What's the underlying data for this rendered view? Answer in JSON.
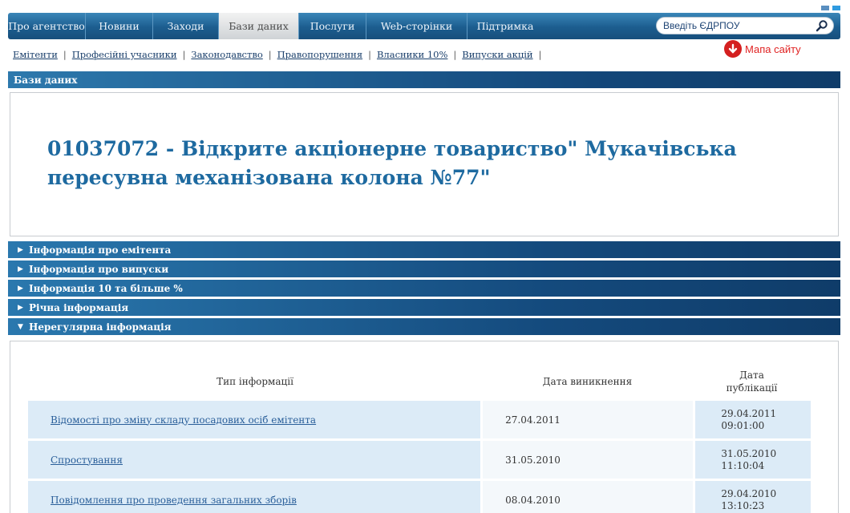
{
  "nav": {
    "tabs": [
      {
        "label": "Про агентство"
      },
      {
        "label": "Новини"
      },
      {
        "label": "Заходи"
      },
      {
        "label": "Бази даних"
      },
      {
        "label": "Послуги"
      },
      {
        "label": "Web-сторінки"
      },
      {
        "label": "Підтримка"
      }
    ],
    "active_tab": "Бази даних",
    "search_placeholder": "Введіть ЄДРПОУ"
  },
  "subnav": {
    "links": [
      {
        "label": "Емітенти"
      },
      {
        "label": "Професійні учасники"
      },
      {
        "label": "Законодавство"
      },
      {
        "label": "Правопорушення"
      },
      {
        "label": "Власники 10%"
      },
      {
        "label": "Випуски акцій"
      }
    ]
  },
  "sitemap_label": "Мапа сайту",
  "section_title": "Бази даних",
  "company_title": "01037072 - Відкрите акціонерне товариство\" Мукачівська пересувна механізована колона №77\"",
  "accordion": [
    {
      "label": "Інформація про емітента",
      "expanded": false
    },
    {
      "label": "Інформація про випуски",
      "expanded": false
    },
    {
      "label": "Інформація 10 та більше %",
      "expanded": false
    },
    {
      "label": "Річна інформація",
      "expanded": false
    },
    {
      "label": "Нерегулярна інформація",
      "expanded": true
    }
  ],
  "table": {
    "headers": {
      "type": "Тип інформації",
      "occurrence": "Дата виникнення",
      "publication_line1": "Дата",
      "publication_line2": "публікації"
    },
    "rows": [
      {
        "type": "Відомості про зміну складу посадових осіб емітента",
        "occurrence": "27.04.2011",
        "pub_date": "29.04.2011",
        "pub_time": "09:01:00"
      },
      {
        "type": "Спростування",
        "occurrence": "31.05.2010",
        "pub_date": "31.05.2010",
        "pub_time": "11:10:04"
      },
      {
        "type": "Повідомлення про проведення загальних зборів",
        "occurrence": "08.04.2010",
        "pub_date": "29.04.2010",
        "pub_time": "13:10:23"
      }
    ]
  },
  "colors": {
    "nav_blue": "#1c5d8f",
    "title_blue": "#1e6aa0",
    "sitemap_red": "#e02222",
    "row_light_blue": "#dcebf7"
  }
}
